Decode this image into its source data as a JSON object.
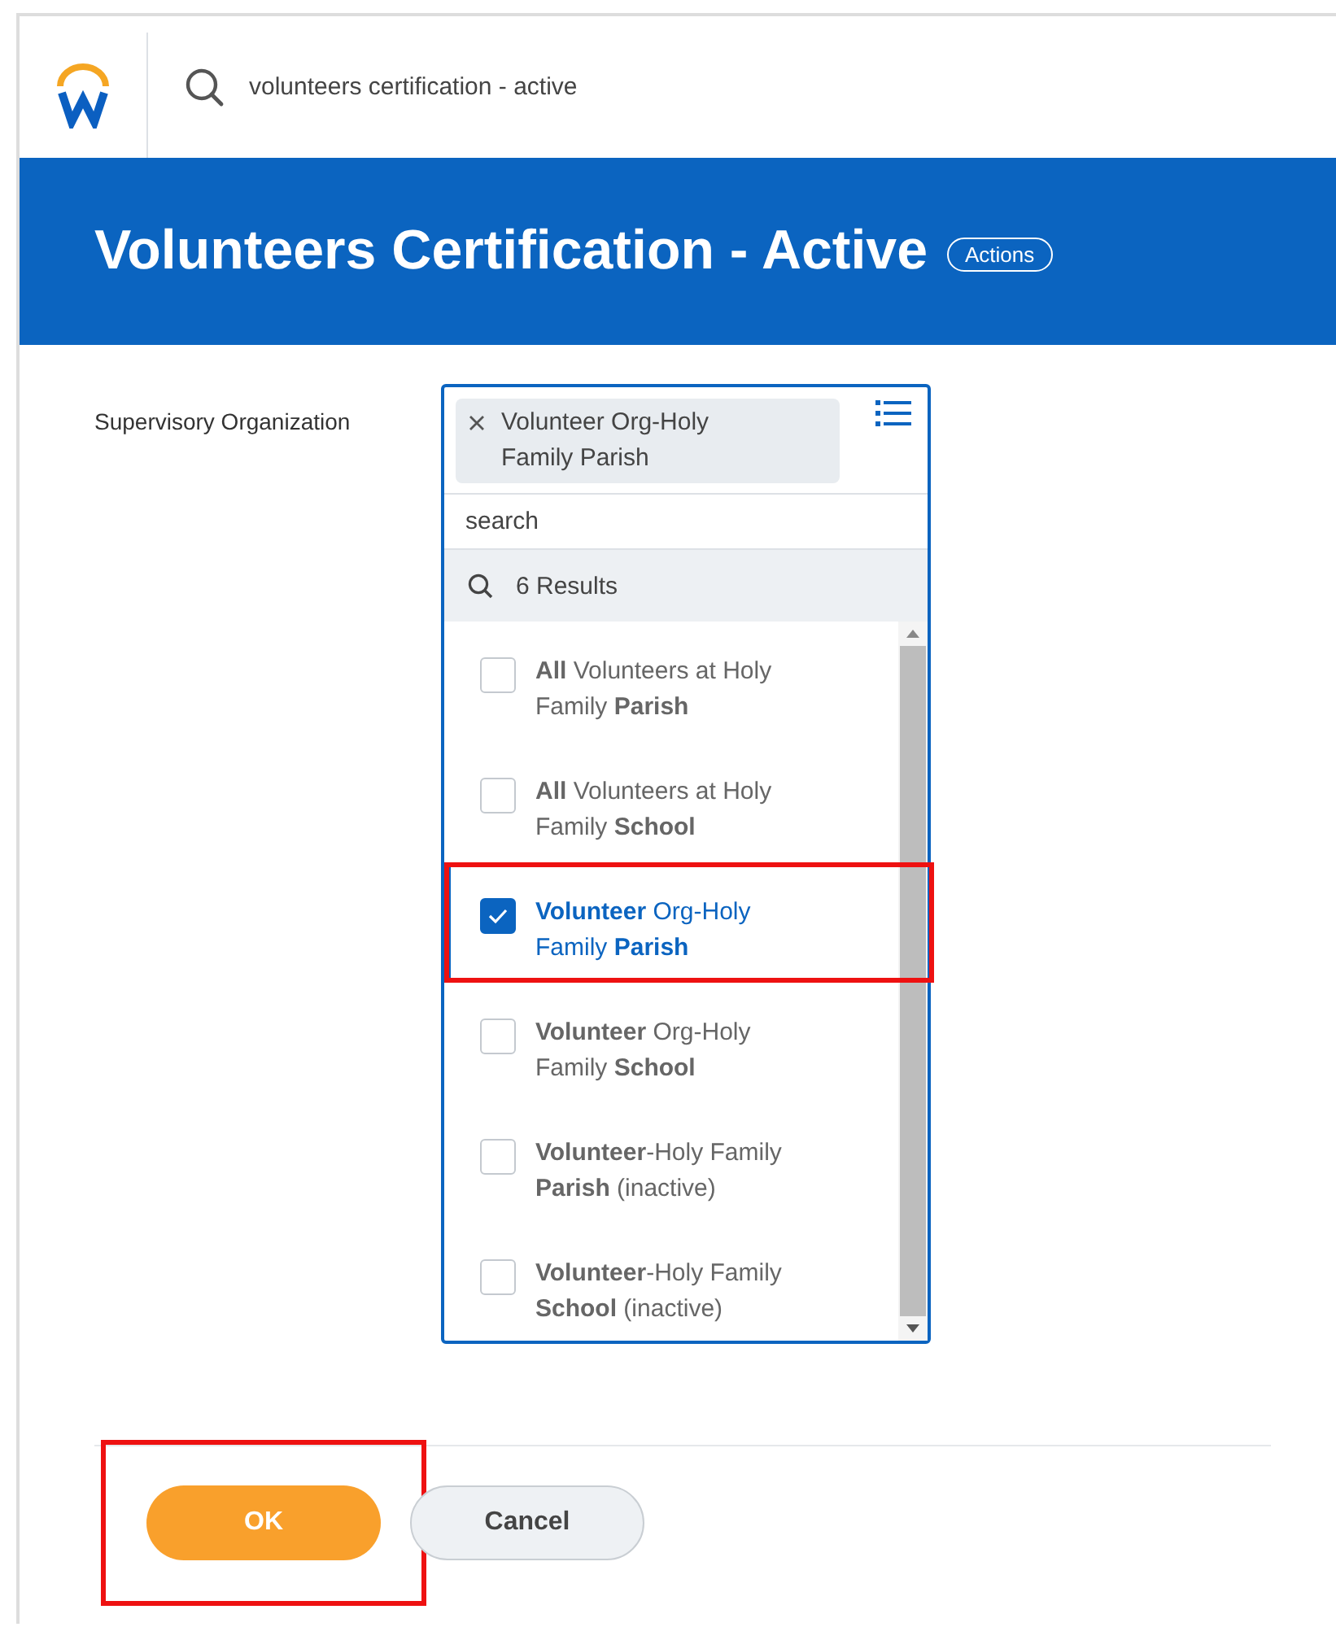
{
  "header": {
    "search_value": "volunteers certification - active"
  },
  "banner": {
    "title": "Volunteers Certification - Active",
    "actions_label": "Actions"
  },
  "field": {
    "label": "Supervisory Organization",
    "chip": "Volunteer Org-Holy Family Parish",
    "search_placeholder": "search",
    "results_count": "6 Results"
  },
  "options": [
    {
      "label": "**All** Volunteers at Holy Family **Parish**",
      "checked": false,
      "highlighted": false
    },
    {
      "label": "**All** Volunteers at Holy Family **School**",
      "checked": false,
      "highlighted": false
    },
    {
      "label": "**Volunteer** Org-Holy Family **Parish**",
      "checked": true,
      "highlighted": true
    },
    {
      "label": "**Volunteer** Org-Holy Family **School**",
      "checked": false,
      "highlighted": false
    },
    {
      "label": "**Volunteer**-Holy Family **Parish** (inactive)",
      "checked": false,
      "highlighted": false
    },
    {
      "label": "**Volunteer**-Holy Family **School** (inactive)",
      "checked": false,
      "highlighted": false
    }
  ],
  "buttons": [
    {
      "label": "OK",
      "kind": "primary",
      "highlighted": true
    },
    {
      "label": "Cancel",
      "kind": "secondary",
      "highlighted": false
    }
  ]
}
